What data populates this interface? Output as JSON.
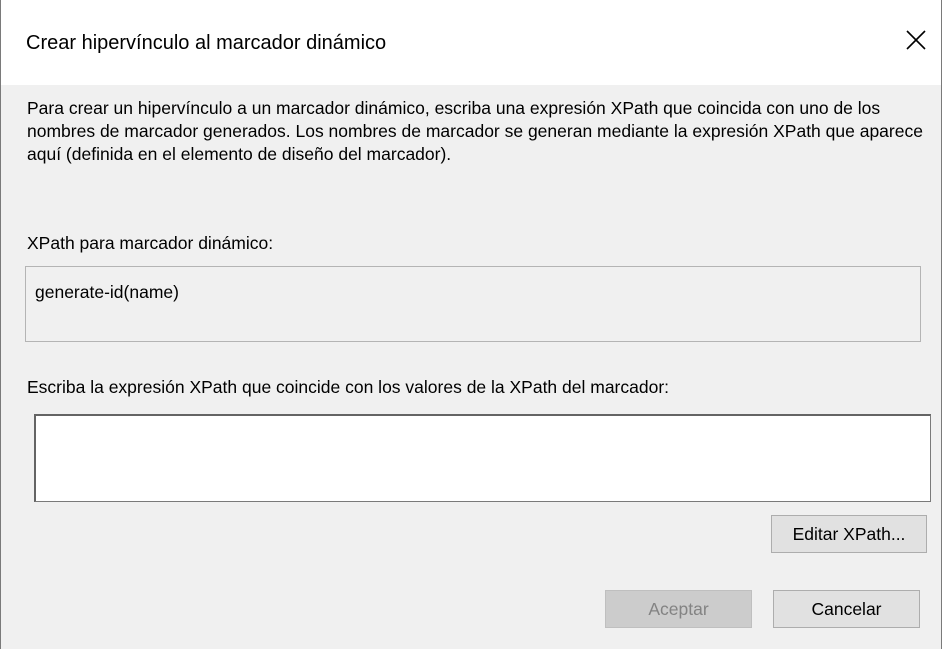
{
  "window": {
    "title": "Crear hipervínculo al marcador dinámico",
    "close_icon": "close-icon"
  },
  "description": "Para crear un hipervínculo a un marcador dinámico, escriba una expresión XPath que coincida con uno de los nombres de marcador generados. Los nombres de marcador se generan mediante la expresión XPath que aparece aquí (definida en el elemento de diseño del marcador).",
  "xpath_label": "XPath para marcador dinámico:",
  "xpath_value": "generate-id(name)",
  "input_label": "Escriba la expresión XPath que coincide con los valores de la XPath del marcador:",
  "input": {
    "value": "",
    "placeholder": ""
  },
  "buttons": {
    "edit_xpath": "Editar XPath...",
    "ok": "Aceptar",
    "ok_enabled": false,
    "cancel": "Cancelar"
  }
}
